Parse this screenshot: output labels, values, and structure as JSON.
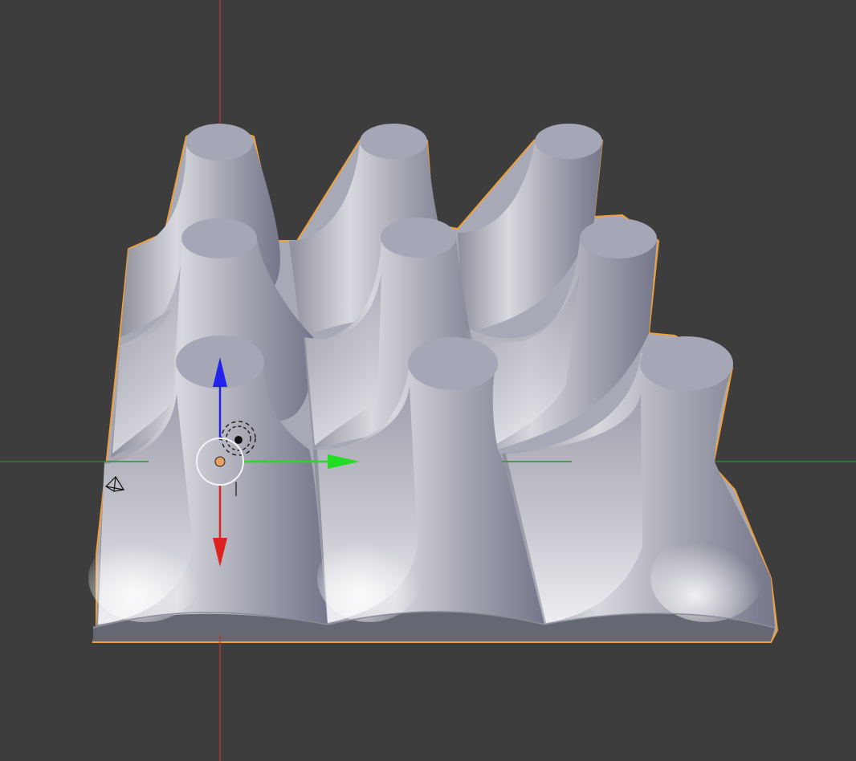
{
  "viewport": {
    "name": "3D Viewport",
    "background": "#3d3d3d"
  },
  "object": {
    "shape": "3x3 grid of flared pillars on a base slab",
    "surface_color": "#a7a9b8",
    "cap_color": "#a5a6b6",
    "base_side_color": "#656772",
    "selection_outline_color": "#f0a03a"
  },
  "axes": {
    "x_axis_color": "#d03a3a",
    "y_axis_color": "#3aa53a"
  },
  "gizmo": {
    "x_arrow_color": "#dd2222",
    "y_arrow_color": "#22dd22",
    "z_arrow_color": "#2222ee",
    "origin_color": "#e8a060"
  },
  "icons": {
    "camera": "camera-icon",
    "cursor3d": "3d-cursor-icon"
  }
}
